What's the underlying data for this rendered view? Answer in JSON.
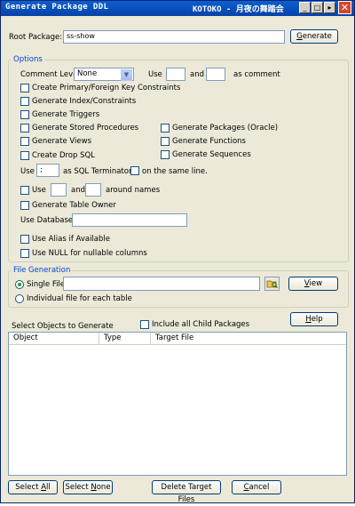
{
  "window": {
    "title": "Generate Package DDL",
    "title_extra": "KOTOKO - 月夜の舞踏会",
    "controls": [
      "minimize-icon",
      "maximize-icon",
      "restore-icon",
      "close-icon"
    ]
  },
  "root_package": {
    "label": "Root Package:",
    "value": "ss-show",
    "generate_label": "Generate",
    "generate_mnemonic": "G"
  },
  "options": {
    "title": "Options",
    "comment_level_label": "Comment Level",
    "comment_level_value": "None",
    "use_label": "Use",
    "and_label": "and",
    "as_comment_label": "as comment",
    "create_pk_fk": "Create Primary/Foreign Key Constraints",
    "gen_index": "Generate Index/Constraints",
    "gen_triggers": "Generate Triggers",
    "gen_stored_procs": "Generate Stored Procedures",
    "gen_packages": "Generate Packages (Oracle)",
    "gen_views": "Generate Views",
    "gen_functions": "Generate Functions",
    "create_drop": "Create Drop SQL",
    "gen_sequences": "Generate Sequences",
    "use2_label": "Use",
    "terminator_value": ";",
    "sql_terminator_label": "as SQL Terminator",
    "same_line_label": "on the same line.",
    "use3_label": "Use",
    "and2_label": "and",
    "around_names_label": "around names",
    "gen_table_owner": "Generate Table Owner",
    "use_database_label": "Use Database",
    "use_alias": "Use Alias if Available",
    "use_null": "Use NULL for nullable columns"
  },
  "file_generation": {
    "title": "File Generation",
    "single_file_label": "Single File",
    "individual_label": "Individual file for each table",
    "view_label": "View",
    "view_mnemonic": "V",
    "folder_icon": "folder-open-icon"
  },
  "objects": {
    "select_label": "Select Objects to Generate",
    "include_child": "Include all Child Packages",
    "help_label": "Help",
    "help_mnemonic": "H",
    "columns": [
      "Object",
      "Type",
      "Target File"
    ]
  },
  "footer": {
    "select_all": "Select All",
    "select_all_mnemonic": "A",
    "select_none": "Select None",
    "select_none_mnemonic": "N",
    "delete_target": "Delete Target Files",
    "cancel": "Cancel",
    "cancel_mnemonic": "C"
  }
}
